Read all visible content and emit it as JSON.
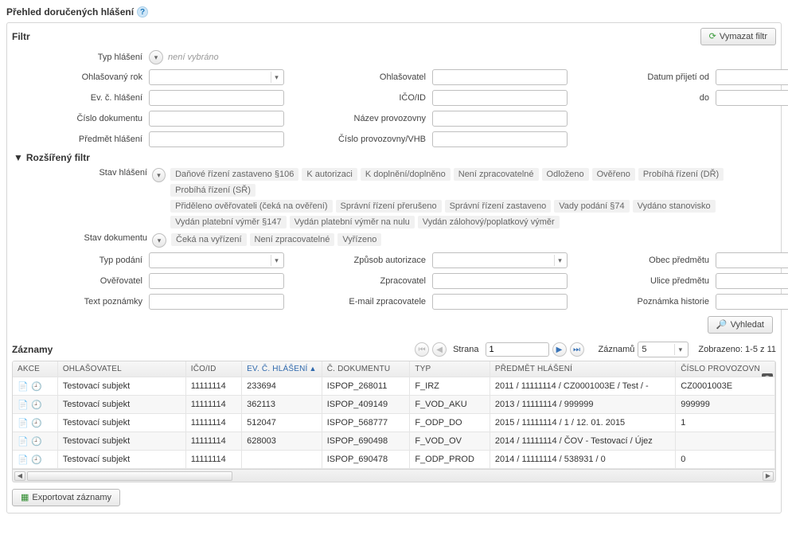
{
  "page_title": "Přehled doručených hlášení",
  "filter": {
    "title": "Filtr",
    "clear_label": "Vymazat filtr",
    "labels": {
      "typ_hlaseni": "Typ hlášení",
      "neni_vybrano": "není vybráno",
      "ohlasovany_rok": "Ohlašovaný rok",
      "ohlasovatel": "Ohlašovatel",
      "datum_od": "Datum přijetí od",
      "ev_c": "Ev. č. hlášení",
      "ico": "IČO/ID",
      "do": "do",
      "cislo_dokumentu": "Číslo dokumentu",
      "nazev_provozovny": "Název provozovny",
      "predmet": "Předmět hlášení",
      "cislo_provozovny": "Číslo provozovny/VHB"
    }
  },
  "advanced": {
    "title": "Rozšířený filtr",
    "labels": {
      "stav_hlaseni": "Stav hlášení",
      "stav_dokumentu": "Stav dokumentu",
      "typ_podani": "Typ podání",
      "zpusob_autorizace": "Způsob autorizace",
      "obec_predmetu": "Obec předmětu",
      "overovatel": "Ověřovatel",
      "zpracovatel": "Zpracovatel",
      "ulice_predmetu": "Ulice předmětu",
      "text_poznamky": "Text poznámky",
      "email_zpracovatele": "E-mail zpracovatele",
      "poznamka_historie": "Poznámka historie"
    },
    "stav_hlaseni_tags": [
      "Daňové řízení zastaveno §106",
      "K autorizaci",
      "K doplnění/doplněno",
      "Není zpracovatelné",
      "Odloženo",
      "Ověřeno",
      "Probíhá řízení (DŘ)",
      "Probíhá řízení (SŘ)",
      "Přiděleno ověřovateli (čeká na ověření)",
      "Správní řízení přerušeno",
      "Správní řízení zastaveno",
      "Vady podání §74",
      "Vydáno stanovisko",
      "Vydán platební výměr §147",
      "Vydán platební výměr na nulu",
      "Vydán zálohový/poplatkový výměr"
    ],
    "stav_dokumentu_tags": [
      "Čeká na vyřízení",
      "Není zpracovatelné",
      "Vyřízeno"
    ],
    "search_label": "Vyhledat"
  },
  "records": {
    "title": "Záznamy",
    "page_label": "Strana",
    "page_value": "1",
    "count_label": "Záznamů",
    "count_value": "5",
    "shown": "Zobrazeno: 1-5 z 11",
    "columns": [
      "AKCE",
      "OHLAŠOVATEL",
      "IČO/ID",
      "EV. Č. HLÁŠENÍ",
      "Č. DOKUMENTU",
      "TYP",
      "PŘEDMĚT HLÁŠENÍ",
      "ČÍSLO PROVOZOVN"
    ],
    "rows": [
      {
        "ohlasovatel": "Testovací subjekt",
        "ico": "11111114",
        "evc": "233694",
        "cdok": "ISPOP_268011",
        "typ": "F_IRZ",
        "predmet": "2011 / 11111114 / CZ0001003E / Test / -",
        "cprov": "CZ0001003E"
      },
      {
        "ohlasovatel": "Testovací subjekt",
        "ico": "11111114",
        "evc": "362113",
        "cdok": "ISPOP_409149",
        "typ": "F_VOD_AKU",
        "predmet": "2013 / 11111114 / 999999",
        "cprov": "999999"
      },
      {
        "ohlasovatel": "Testovací subjekt",
        "ico": "11111114",
        "evc": "512047",
        "cdok": "ISPOP_568777",
        "typ": "F_ODP_DO",
        "predmet": "2015 / 11111114 / 1 / 12. 01. 2015",
        "cprov": "1"
      },
      {
        "ohlasovatel": "Testovací subjekt",
        "ico": "11111114",
        "evc": "628003",
        "cdok": "ISPOP_690498",
        "typ": "F_VOD_OV",
        "predmet": "2014 / 11111114 / ČOV - Testovací / Újez",
        "cprov": ""
      },
      {
        "ohlasovatel": "Testovací subjekt",
        "ico": "11111114",
        "evc": "",
        "cdok": "ISPOP_690478",
        "typ": "F_ODP_PROD",
        "predmet": "2014 / 11111114 / 538931 / 0",
        "cprov": "0"
      }
    ]
  },
  "export_label": "Exportovat záznamy"
}
